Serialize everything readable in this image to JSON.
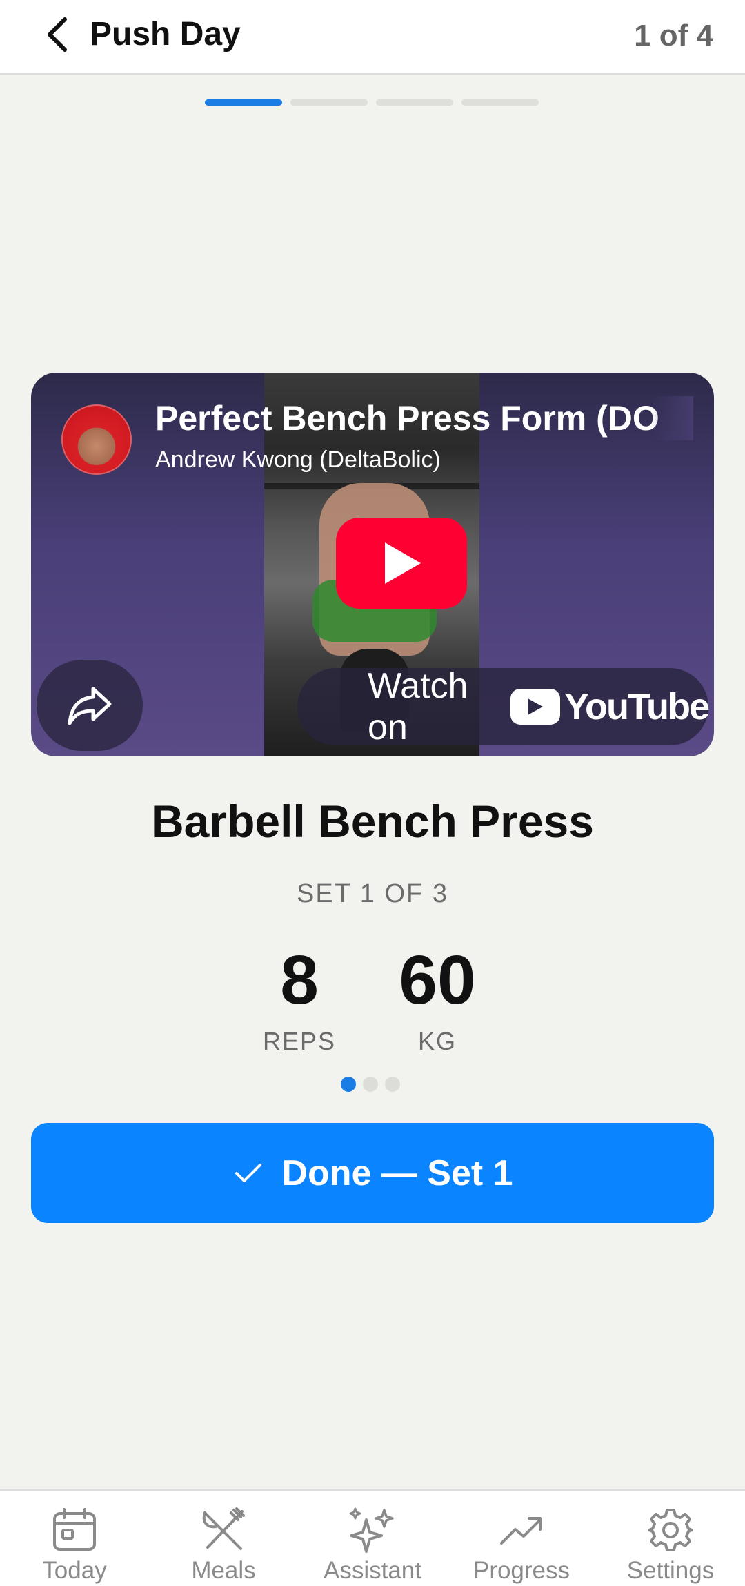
{
  "header": {
    "title": "Push Day",
    "step_counter": "1 of 4",
    "steps_total": 4,
    "steps_current": 1
  },
  "video": {
    "title": "Perfect Bench Press Form (DO",
    "channel": "Andrew Kwong (DeltaBolic)",
    "watch_on": "Watch on",
    "platform": "YouTube"
  },
  "exercise": {
    "name": "Barbell Bench Press",
    "set_label": "SET 1 OF 3",
    "reps_value": "8",
    "reps_unit": "REPS",
    "weight_value": "60",
    "weight_unit": "KG",
    "sets_total": 3,
    "set_current": 1
  },
  "actions": {
    "done_label": "Done — Set 1"
  },
  "tabbar": {
    "items": [
      {
        "label": "Today",
        "icon": "calendar-icon"
      },
      {
        "label": "Meals",
        "icon": "fork-knife-icon"
      },
      {
        "label": "Assistant",
        "icon": "sparkles-icon"
      },
      {
        "label": "Progress",
        "icon": "trend-up-icon"
      },
      {
        "label": "Settings",
        "icon": "gear-icon"
      }
    ]
  },
  "colors": {
    "accent": "#0a84ff",
    "progress_active": "#1a7de6",
    "youtube_red": "#ff0033",
    "background": "#f2f2ee"
  }
}
